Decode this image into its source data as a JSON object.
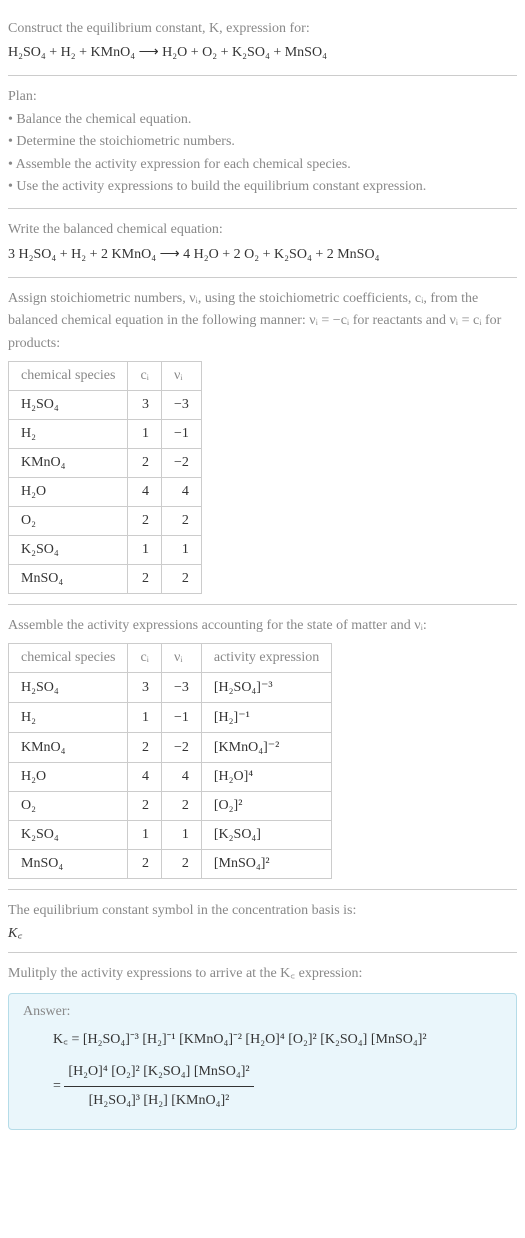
{
  "header": {
    "prompt": "Construct the equilibrium constant, K, expression for:",
    "equation": "H₂SO₄ + H₂ + KMnO₄ ⟶ H₂O + O₂ + K₂SO₄ + MnSO₄"
  },
  "plan": {
    "title": "Plan:",
    "items": [
      "• Balance the chemical equation.",
      "• Determine the stoichiometric numbers.",
      "• Assemble the activity expression for each chemical species.",
      "• Use the activity expressions to build the equilibrium constant expression."
    ]
  },
  "balanced": {
    "label": "Write the balanced chemical equation:",
    "equation": "3 H₂SO₄ + H₂ + 2 KMnO₄ ⟶ 4 H₂O + 2 O₂ + K₂SO₄ + 2 MnSO₄"
  },
  "stoich": {
    "intro": "Assign stoichiometric numbers, νᵢ, using the stoichiometric coefficients, cᵢ, from the balanced chemical equation in the following manner: νᵢ = −cᵢ for reactants and νᵢ = cᵢ for products:",
    "headers": {
      "species": "chemical species",
      "ci": "cᵢ",
      "vi": "νᵢ"
    },
    "rows": [
      {
        "species": "H₂SO₄",
        "ci": "3",
        "vi": "−3"
      },
      {
        "species": "H₂",
        "ci": "1",
        "vi": "−1"
      },
      {
        "species": "KMnO₄",
        "ci": "2",
        "vi": "−2"
      },
      {
        "species": "H₂O",
        "ci": "4",
        "vi": "4"
      },
      {
        "species": "O₂",
        "ci": "2",
        "vi": "2"
      },
      {
        "species": "K₂SO₄",
        "ci": "1",
        "vi": "1"
      },
      {
        "species": "MnSO₄",
        "ci": "2",
        "vi": "2"
      }
    ]
  },
  "activity": {
    "intro": "Assemble the activity expressions accounting for the state of matter and νᵢ:",
    "headers": {
      "species": "chemical species",
      "ci": "cᵢ",
      "vi": "νᵢ",
      "expr": "activity expression"
    },
    "rows": [
      {
        "species": "H₂SO₄",
        "ci": "3",
        "vi": "−3",
        "expr": "[H₂SO₄]⁻³"
      },
      {
        "species": "H₂",
        "ci": "1",
        "vi": "−1",
        "expr": "[H₂]⁻¹"
      },
      {
        "species": "KMnO₄",
        "ci": "2",
        "vi": "−2",
        "expr": "[KMnO₄]⁻²"
      },
      {
        "species": "H₂O",
        "ci": "4",
        "vi": "4",
        "expr": "[H₂O]⁴"
      },
      {
        "species": "O₂",
        "ci": "2",
        "vi": "2",
        "expr": "[O₂]²"
      },
      {
        "species": "K₂SO₄",
        "ci": "1",
        "vi": "1",
        "expr": "[K₂SO₄]"
      },
      {
        "species": "MnSO₄",
        "ci": "2",
        "vi": "2",
        "expr": "[MnSO₄]²"
      }
    ]
  },
  "symbol": {
    "label": "The equilibrium constant symbol in the concentration basis is:",
    "value": "K꜀"
  },
  "final": {
    "label": "Mulitply the activity expressions to arrive at the K꜀ expression:",
    "answer_label": "Answer:",
    "line1": "K꜀ = [H₂SO₄]⁻³ [H₂]⁻¹ [KMnO₄]⁻² [H₂O]⁴ [O₂]² [K₂SO₄] [MnSO₄]²",
    "frac_num": "[H₂O]⁴ [O₂]² [K₂SO₄] [MnSO₄]²",
    "frac_den": "[H₂SO₄]³ [H₂] [KMnO₄]²",
    "equals": "="
  },
  "chart_data": {
    "type": "table",
    "tables": [
      {
        "title": "Stoichiometric numbers",
        "columns": [
          "chemical species",
          "cᵢ",
          "νᵢ"
        ],
        "rows": [
          [
            "H₂SO₄",
            3,
            -3
          ],
          [
            "H₂",
            1,
            -1
          ],
          [
            "KMnO₄",
            2,
            -2
          ],
          [
            "H₂O",
            4,
            4
          ],
          [
            "O₂",
            2,
            2
          ],
          [
            "K₂SO₄",
            1,
            1
          ],
          [
            "MnSO₄",
            2,
            2
          ]
        ]
      },
      {
        "title": "Activity expressions",
        "columns": [
          "chemical species",
          "cᵢ",
          "νᵢ",
          "activity expression"
        ],
        "rows": [
          [
            "H₂SO₄",
            3,
            -3,
            "[H₂SO₄]^-3"
          ],
          [
            "H₂",
            1,
            -1,
            "[H₂]^-1"
          ],
          [
            "KMnO₄",
            2,
            -2,
            "[KMnO₄]^-2"
          ],
          [
            "H₂O",
            4,
            4,
            "[H₂O]^4"
          ],
          [
            "O₂",
            2,
            2,
            "[O₂]^2"
          ],
          [
            "K₂SO₄",
            1,
            1,
            "[K₂SO₄]"
          ],
          [
            "MnSO₄",
            2,
            2,
            "[MnSO₄]^2"
          ]
        ]
      }
    ]
  }
}
